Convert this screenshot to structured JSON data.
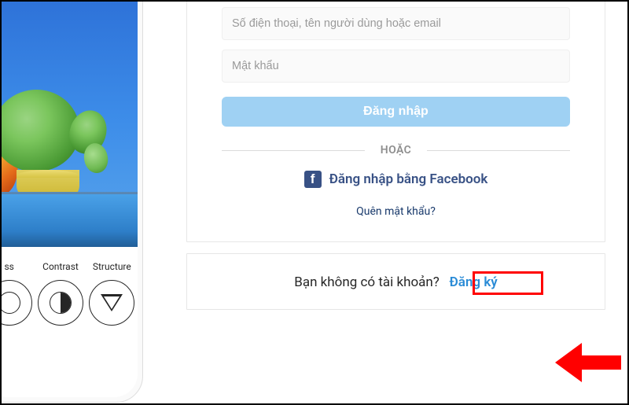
{
  "tools": {
    "brightness": {
      "label": "ss"
    },
    "contrast": {
      "label": "Contrast"
    },
    "structure": {
      "label": "Structure"
    }
  },
  "login": {
    "username_placeholder": "Số điện thoại, tên người dùng hoặc email",
    "password_placeholder": "Mật khẩu",
    "login_button": "Đăng nhập",
    "divider": "HOẶC",
    "fb_login": "Đăng nhập bằng Facebook",
    "forgot": "Quên mật khẩu?"
  },
  "signup": {
    "prompt": "Bạn không có tài khoản?",
    "link": "Đăng ký"
  }
}
